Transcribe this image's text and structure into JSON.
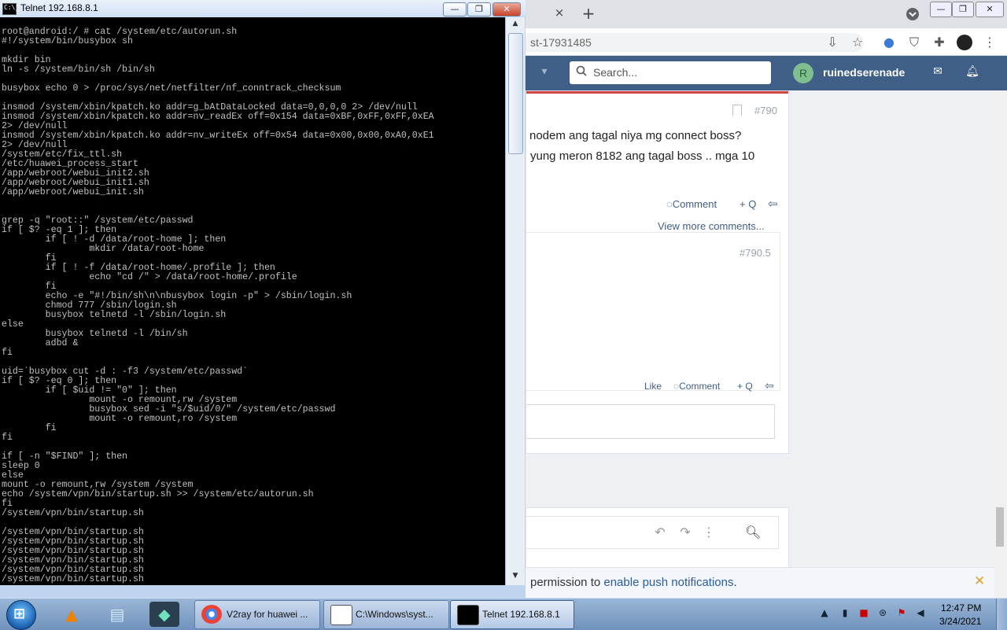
{
  "chrome": {
    "tab_close": "×",
    "tab_new": "+",
    "win_min": "—",
    "win_max": "❐",
    "win_close": "✕",
    "url_text": "st-17931485",
    "site": {
      "search_placeholder": "Search...",
      "user_initial": "R",
      "username": "ruinedserenade"
    },
    "post": {
      "number": "#790",
      "line1": "nodem ang tagal niya mg connect boss?",
      "line2": "yung meron 8182 ang tagal boss .. mga 10",
      "comment_label": "Comment",
      "quote_label": "+ Q",
      "view_more": "View more comments...",
      "reply_number": "#790.5",
      "like_label": "Like",
      "reply_comment_label": "Comment",
      "reply_quote_label": "+ Q"
    },
    "notification": {
      "prefix": "permission to ",
      "link": "enable push notifications",
      "suffix": ".",
      "close": "✕"
    }
  },
  "telnet": {
    "title": "Telnet 192.168.8.1",
    "icon_text": "C:\\_",
    "btn_min": "—",
    "btn_max": "❐",
    "btn_close": "✕",
    "lines": [
      "root@android:/ # cat /system/etc/autorun.sh",
      "#!/system/bin/busybox sh",
      "",
      "mkdir bin",
      "ln -s /system/bin/sh /bin/sh",
      "",
      "busybox echo 0 > /proc/sys/net/netfilter/nf_conntrack_checksum",
      "",
      "insmod /system/xbin/kpatch.ko addr=g_bAtDataLocked data=0,0,0,0 2> /dev/null",
      "insmod /system/xbin/kpatch.ko addr=nv_readEx off=0x154 data=0xBF,0xFF,0xFF,0xEA",
      "2> /dev/null",
      "insmod /system/xbin/kpatch.ko addr=nv_writeEx off=0x54 data=0x00,0x00,0xA0,0xE1",
      "2> /dev/null",
      "/system/etc/fix_ttl.sh",
      "/etc/huawei_process_start",
      "/app/webroot/webui_init2.sh",
      "/app/webroot/webui_init1.sh",
      "/app/webroot/webui_init.sh",
      "",
      "",
      "grep -q \"root::\" /system/etc/passwd",
      "if [ $? -eq 1 ]; then",
      "        if [ ! -d /data/root-home ]; then",
      "                mkdir /data/root-home",
      "        fi",
      "        if [ ! -f /data/root-home/.profile ]; then",
      "                echo \"cd /\" > /data/root-home/.profile",
      "        fi",
      "        echo -e \"#!/bin/sh\\n\\nbusybox login -p\" > /sbin/login.sh",
      "        chmod 777 /sbin/login.sh",
      "        busybox telnetd -l /sbin/login.sh",
      "else",
      "        busybox telnetd -l /bin/sh",
      "        adbd &",
      "fi",
      "",
      "uid=`busybox cut -d : -f3 /system/etc/passwd`",
      "if [ $? -eq 0 ]; then",
      "        if [ $uid != \"0\" ]; then",
      "                mount -o remount,rw /system",
      "                busybox sed -i \"s/$uid/0/\" /system/etc/passwd",
      "                mount -o remount,ro /system",
      "        fi",
      "fi",
      "",
      "if [ -n \"$FIND\" ]; then",
      "sleep 0",
      "else",
      "mount -o remount,rw /system /system",
      "echo /system/vpn/bin/startup.sh >> /system/etc/autorun.sh",
      "fi",
      "/system/vpn/bin/startup.sh",
      "",
      "/system/vpn/bin/startup.sh",
      "/system/vpn/bin/startup.sh",
      "/system/vpn/bin/startup.sh",
      "/system/vpn/bin/startup.sh",
      "/system/vpn/bin/startup.sh",
      "/system/vpn/bin/startup.sh"
    ]
  },
  "taskbar": {
    "tasks": [
      {
        "label": "V2ray for huawei ..."
      },
      {
        "label": "C:\\Windows\\syst..."
      },
      {
        "label": "Telnet 192.168.8.1"
      }
    ],
    "clock_time": "12:47 PM",
    "clock_date": "3/24/2021"
  },
  "colors": {
    "site_header": "#3f5f86",
    "link": "#2b5c9b",
    "console_bg": "#000000",
    "console_fg": "#c0c0c0"
  }
}
